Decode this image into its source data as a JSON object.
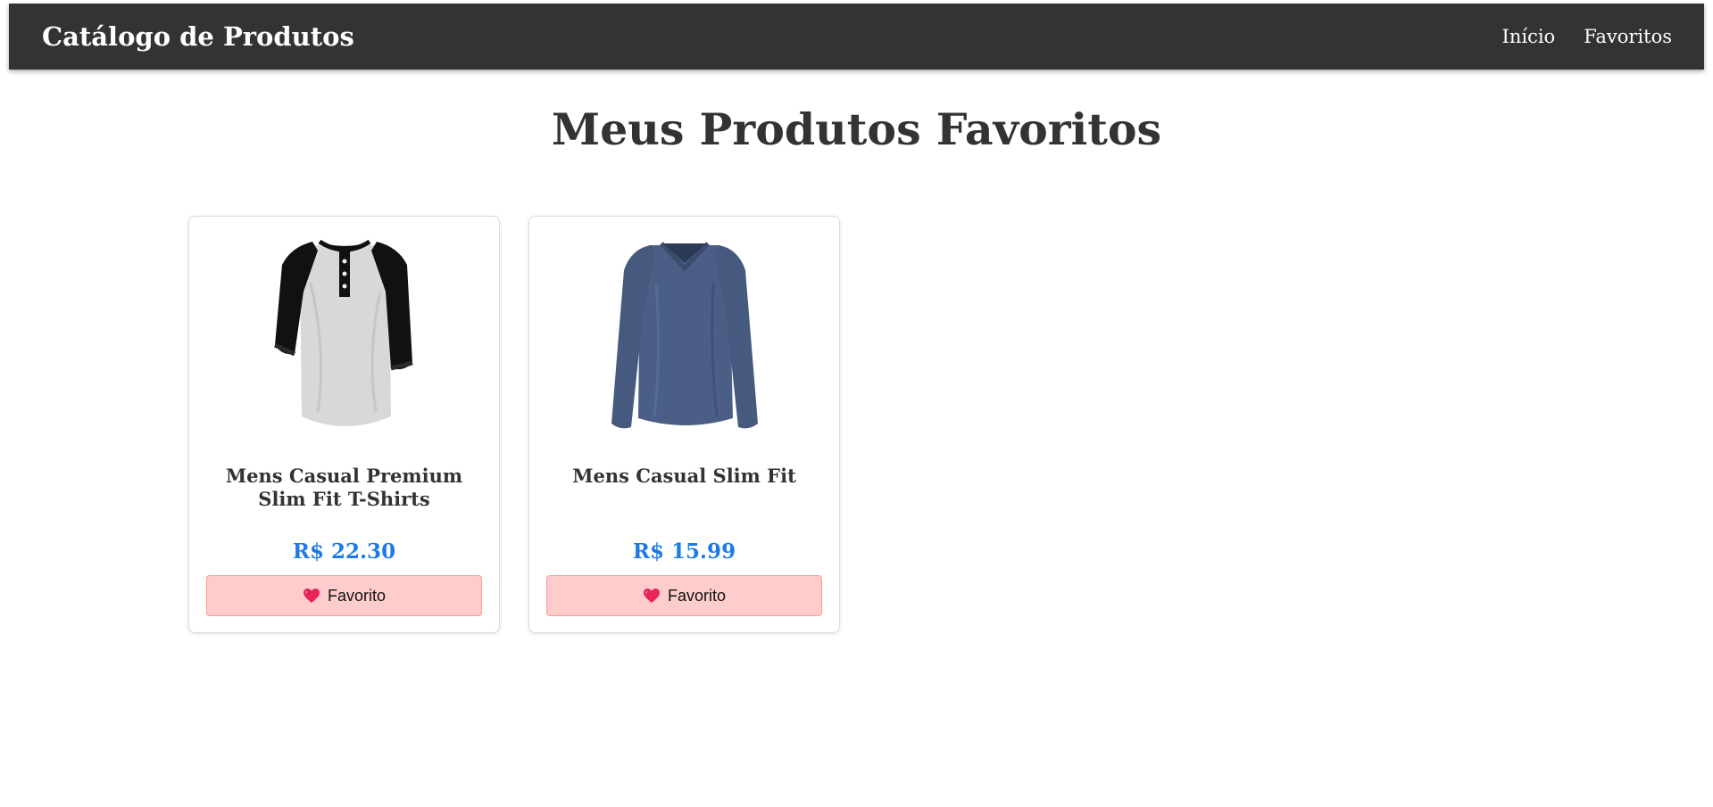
{
  "header": {
    "brand": "Catálogo de Produtos",
    "nav": [
      {
        "label": "Início"
      },
      {
        "label": "Favoritos"
      }
    ]
  },
  "main": {
    "title": "Meus Produtos Favoritos",
    "products": [
      {
        "title": "Mens Casual Premium Slim Fit T-Shirts",
        "price": "R$ 22.30",
        "button_label": "Favorito",
        "button_icon": "heart-icon",
        "image": "raglan-henley-shirt"
      },
      {
        "title": "Mens Casual Slim Fit",
        "price": "R$ 15.99",
        "button_label": "Favorito",
        "button_icon": "heart-icon",
        "image": "blue-long-sleeve-shirt"
      }
    ]
  },
  "colors": {
    "navbar": "#333333",
    "price": "#1e7be6",
    "favorite_button_bg": "#ffcccc",
    "heart": "#e8245a"
  }
}
